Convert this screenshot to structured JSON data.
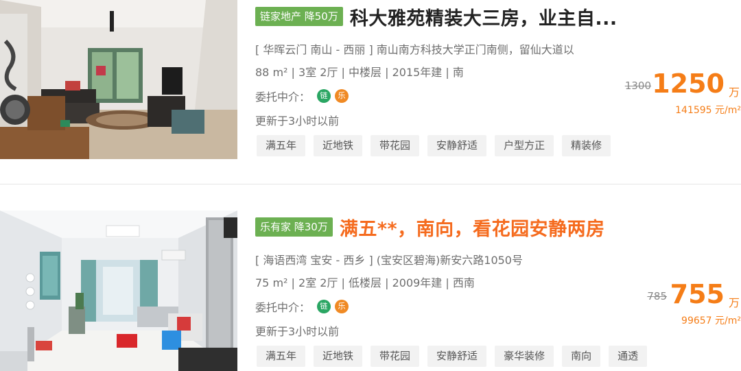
{
  "listings": [
    {
      "agency_tag": "链家地产 降50万",
      "title": "科大雅苑精装大三房，业主自...",
      "address": "[ 华晖云门 南山 - 西丽 ] 南山南方科技大学正门南侧，留仙大道以",
      "specs": "88 m² | 3室 2厅 | 中楼层 | 2015年建 | 南",
      "agents_label": "委托中介：",
      "agent_badges": [
        "链",
        "乐"
      ],
      "updated": "更新于3小时以前",
      "tags": [
        "满五年",
        "近地铁",
        "带花园",
        "安静舒适",
        "户型方正",
        "精装修"
      ],
      "old_price": "1300",
      "price": "1250",
      "price_unit": "万",
      "unit_price": "141595 元/m²"
    },
    {
      "agency_tag": "乐有家 降30万",
      "title": "满五**，南向，看花园安静两房",
      "address": "[ 海语西湾 宝安 - 西乡 ] (宝安区碧海)新安六路1050号",
      "specs": "75 m² | 2室 2厅 | 低楼层 | 2009年建 | 西南",
      "agents_label": "委托中介：",
      "agent_badges": [
        "链",
        "乐"
      ],
      "updated": "更新于3小时以前",
      "tags": [
        "满五年",
        "近地铁",
        "带花园",
        "安静舒适",
        "豪华装修",
        "南向",
        "通透"
      ],
      "old_price": "785",
      "price": "755",
      "price_unit": "万",
      "unit_price": "99657 元/m²"
    }
  ],
  "colors": {
    "agency_green": "#6cb052",
    "price_orange": "#f57d17",
    "title_orange": "#f56b1e",
    "agent_green": "#2aa663",
    "agent_orange": "#f08a24"
  }
}
